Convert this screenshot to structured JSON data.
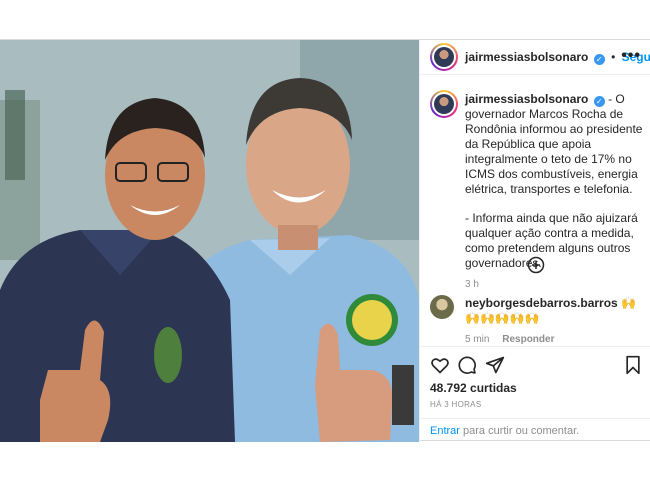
{
  "post": {
    "username": "jairmessiasbolsonaro",
    "follow_label": "Seguir",
    "more_label": "•••",
    "caption": {
      "username": "jairmessiasbolsonaro",
      "paragraph1": "- O governador Marcos Rocha de Rondônia informou ao presidente da República que apoia integralmente o teto de 17% no ICMS dos combustíveis, energia elétrica, transportes e telefonia.",
      "paragraph2": "- Informa ainda que não ajuizará qualquer ação contra a medida, como pretendem alguns outros governadores.",
      "time": "3 h"
    },
    "comment": {
      "username": "neyborgesdebarros.barros",
      "text": "🙌🙌🙌🙌🙌🙌",
      "time": "5 min",
      "reply_label": "Responder"
    },
    "likes": "48.792 curtidas",
    "posted_ago": "HÁ 3 HORAS",
    "login": {
      "link": "Entrar",
      "rest": " para curtir ou comentar."
    }
  },
  "icons": {
    "verified": "verified-badge-icon",
    "more": "more-options-icon",
    "load_more": "add-circle-icon",
    "like": "heart-icon",
    "comment": "comment-icon",
    "share": "share-icon",
    "save": "bookmark-icon"
  },
  "colors": {
    "accent": "#0095f6",
    "verified": "#3897f0",
    "muted": "#8e8e8e",
    "border": "#dbdbdb"
  }
}
